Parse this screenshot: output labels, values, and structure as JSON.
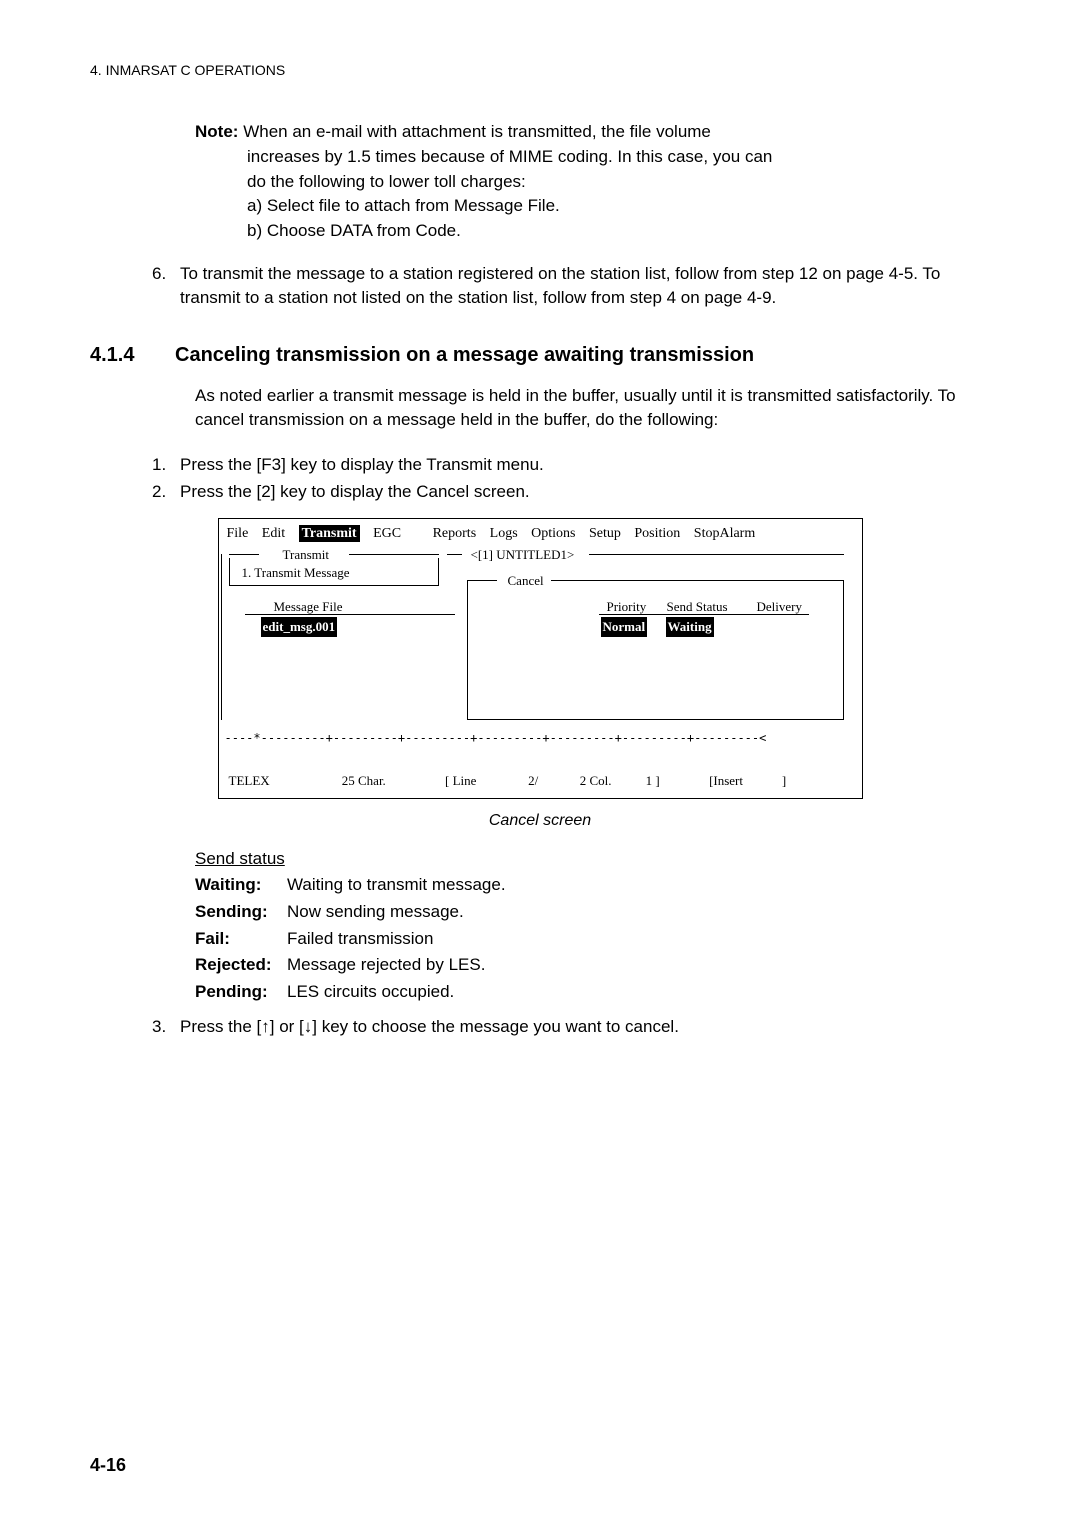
{
  "header": "4. INMARSAT C OPERATIONS",
  "note": {
    "label": "Note:",
    "text1": "When an e-mail with attachment is transmitted, the file volume",
    "text2": "increases by 1.5 times because of MIME coding. In this case, you can",
    "text3": "do the following to lower toll charges:",
    "line_a": "a) Select file to attach from Message File.",
    "line_b": "b) Choose DATA from Code."
  },
  "step6": {
    "num": "6.",
    "text": "To transmit the message to a station registered on the station list, follow from step 12 on page 4-5. To transmit to a station not listed on the station list, follow from step 4 on page 4-9."
  },
  "heading": {
    "num": "4.1.4",
    "text": "Canceling transmission on a message awaiting transmission"
  },
  "para1": "As noted earlier a transmit message is held in the buffer, usually until it is transmitted satisfactorily. To cancel transmission on a message held in the buffer, do the following:",
  "step1": {
    "num": "1.",
    "text": "Press the [F3] key to display the Transmit menu."
  },
  "step2": {
    "num": "2.",
    "text": "Press the [2] key to display the Cancel screen."
  },
  "screen": {
    "menubar": {
      "file": "File",
      "edit": "Edit",
      "transmit": "Transmit",
      "egc": "EGC",
      "reports": "Reports",
      "logs": "Logs",
      "options": "Options",
      "setup": "Setup",
      "position": "Position",
      "stopalarm": "StopAlarm"
    },
    "transmit_label": "Transmit",
    "transmit_item1": "1. Transmit Message",
    "untitled_label": "<[1] UNTITLED1>",
    "cancel_label": "Cancel",
    "cols": {
      "msgfile": "Message File",
      "priority": "Priority",
      "sendstatus": "Send Status",
      "delivery": "Delivery"
    },
    "row": {
      "file": "edit_msg.001",
      "priority": "Normal",
      "status": "Waiting"
    },
    "ruler": "----*---------+---------+---------+---------+---------+---------+---------<",
    "status": {
      "mode": "TELEX",
      "char": "25 Char.",
      "line_lbl": "[ Line",
      "line_val": "2/",
      "col_lbl": "2   Col.",
      "col_val": "1  ]",
      "insert": "[Insert",
      "bracket": "]"
    }
  },
  "caption": "Cancel screen",
  "sendstatus": {
    "title": "Send status",
    "rows": [
      {
        "term": "Waiting:",
        "desc": "Waiting to transmit message."
      },
      {
        "term": "Sending:",
        "desc": "Now sending message."
      },
      {
        "term": "Fail:",
        "desc": "Failed transmission"
      },
      {
        "term": "Rejected:",
        "desc": "Message rejected by LES."
      },
      {
        "term": "Pending:",
        "desc": "LES circuits occupied."
      }
    ]
  },
  "step3": {
    "num": "3.",
    "text": "Press the [↑] or [↓] key to choose the message you want to cancel."
  },
  "page": "4-16"
}
